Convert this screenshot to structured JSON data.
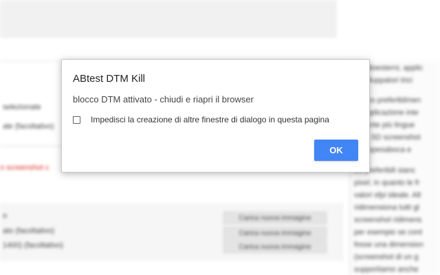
{
  "background": {
    "left_lines": [
      "selezionate",
      "ale (facoltativo)",
      "o screenshot c",
      "o",
      "ato (facoltativo)",
      "1400) (facoltativo)"
    ],
    "buttons": [
      "Carica nuova immagine",
      "Carica nuova immagine",
      "Carica nuova immagine"
    ],
    "right_lines": [
      "Il sottoesterni, applic",
      "e sviluppatori trici",
      "fronco preferibilmen",
      "la applicazione inte",
      "iziponte più lingue",
      "ppo, SD screenshot",
      "e di spesaboca e",
      "tre preferibili sianc",
      "pixel; in quanto le fr",
      "valori sfpi ideale. Alt",
      "ridimensiona tutti gl",
      "screenshot ridimens",
      "per esempio se cont",
      "fosse una dimension",
      "(screenshot di un g",
      "supportiamo anche"
    ]
  },
  "dialog": {
    "title": "ABtest DTM Kill",
    "message": "blocco DTM attivato - chiudi e riapri il browser",
    "checkbox_label": "Impedisci la creazione di altre finestre di dialogo in questa pagina",
    "ok_label": "OK",
    "accent_color": "#4285f4"
  }
}
